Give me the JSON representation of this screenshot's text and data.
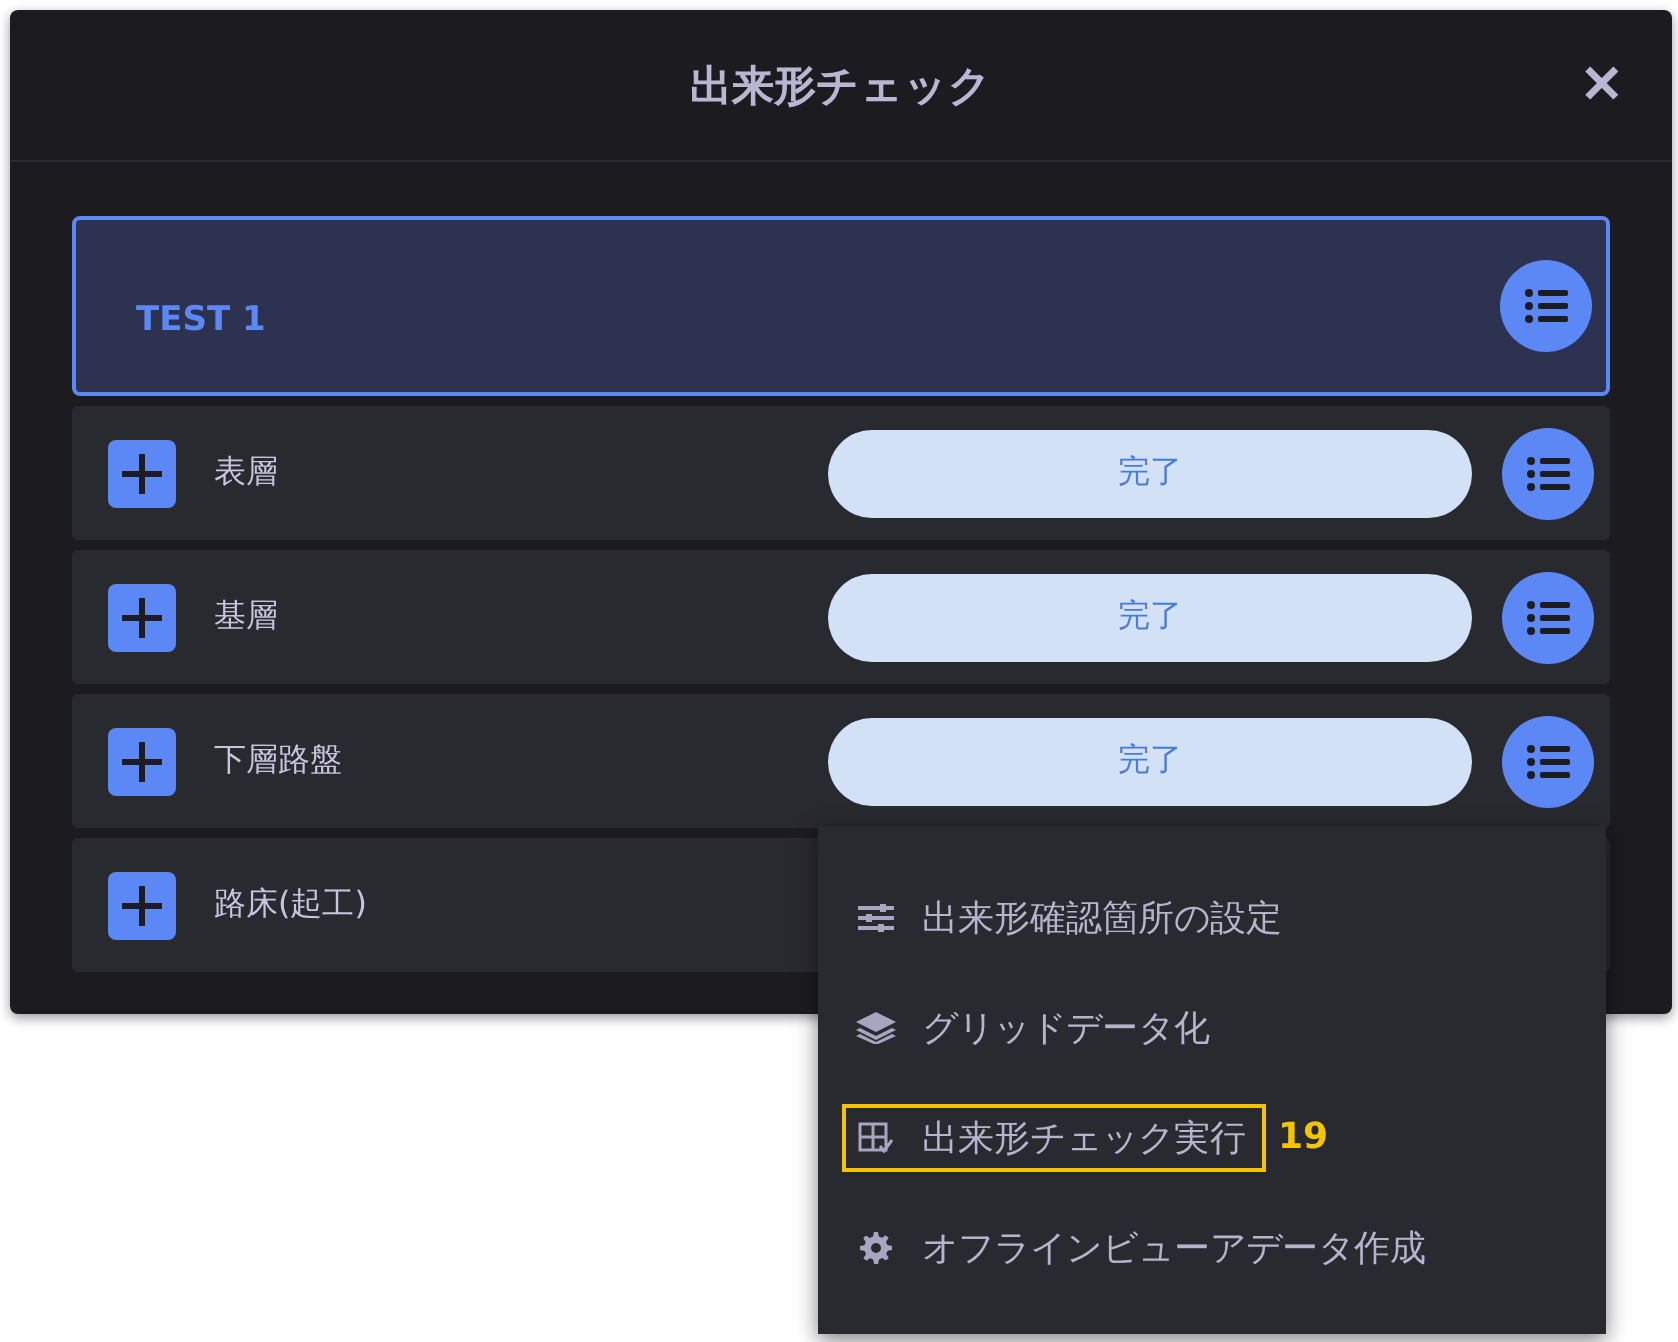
{
  "dialog": {
    "title": "出来形チェック",
    "close": "✕"
  },
  "group": {
    "name": "TEST 1"
  },
  "rows": [
    {
      "name": "表層",
      "status": "完了"
    },
    {
      "name": "基層",
      "status": "完了"
    },
    {
      "name": "下層路盤",
      "status": "完了"
    },
    {
      "name": "路床(起工)"
    }
  ],
  "menu": {
    "items": [
      {
        "kind": "sliders",
        "label": "出来形確認箇所の設定",
        "highlighted": false
      },
      {
        "kind": "layers",
        "label": "グリッドデータ化",
        "highlighted": false
      },
      {
        "kind": "check",
        "label": "出来形チェック実行",
        "highlighted": true,
        "callout": "19"
      },
      {
        "kind": "gear",
        "label": "オフラインビューアデータ作成",
        "highlighted": false
      }
    ]
  }
}
